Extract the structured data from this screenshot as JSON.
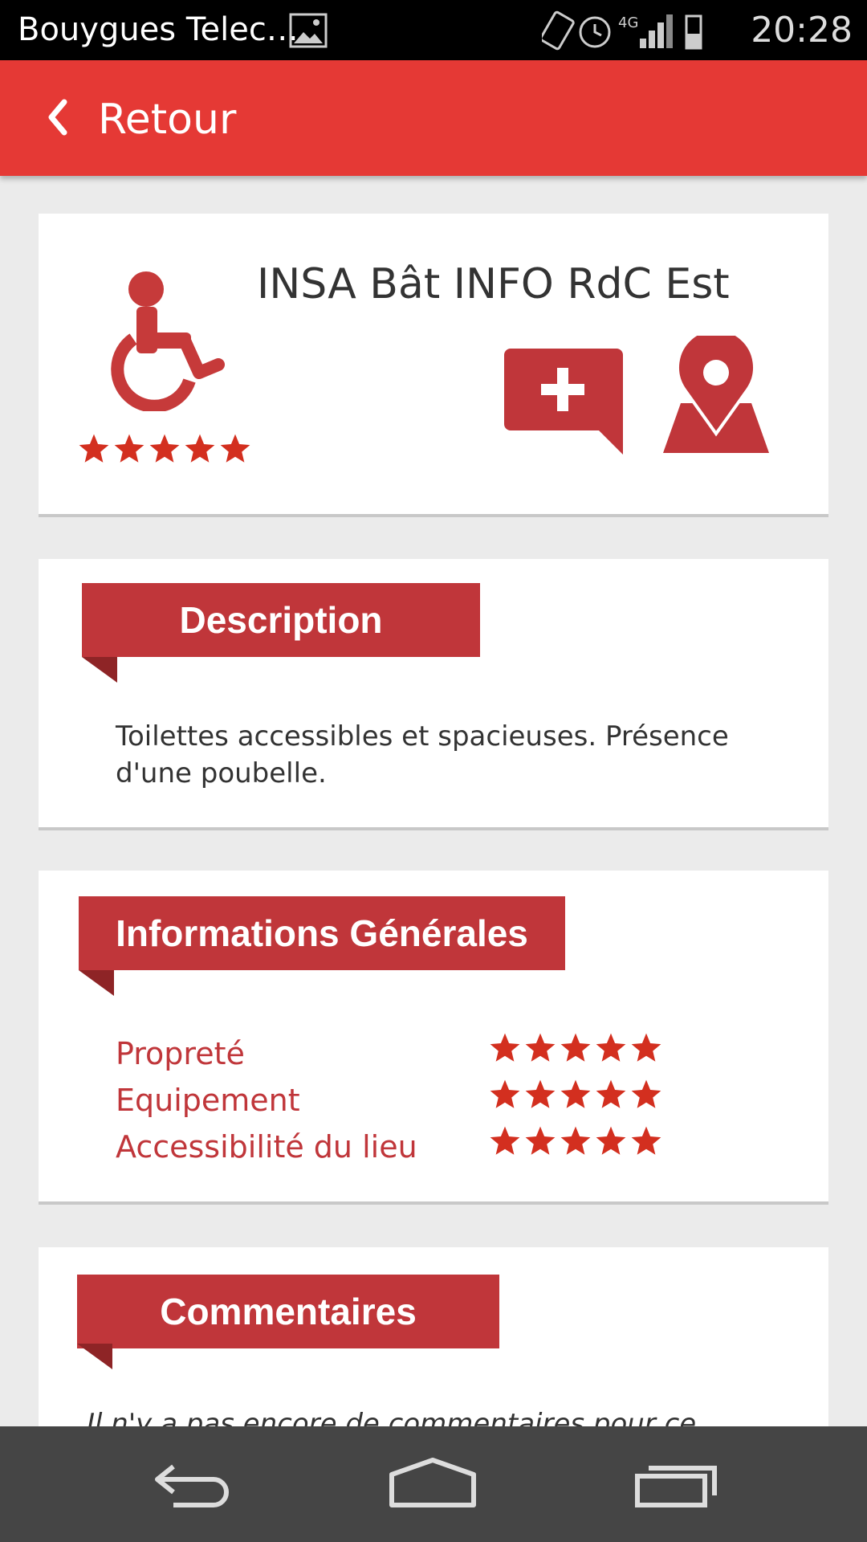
{
  "status_bar": {
    "carrier": "Bouygues Telec…",
    "network": "4G",
    "time": "20:28"
  },
  "app_bar": {
    "back_label": "Retour"
  },
  "place": {
    "title": "INSA Bât INFO RdC Est",
    "overall_rating": 5,
    "overall_rating_max": 5
  },
  "description": {
    "heading": "Description",
    "text": "Toilettes accessibles et spacieuses. Présence d'une poubelle."
  },
  "general_info": {
    "heading": "Informations Générales",
    "ratings": [
      {
        "label": "Propreté",
        "value": 5,
        "max": 5
      },
      {
        "label": "Equipement",
        "value": 5,
        "max": 5
      },
      {
        "label": "Accessibilité du lieu",
        "value": 5,
        "max": 5
      }
    ]
  },
  "comments": {
    "heading": "Commentaires",
    "empty_text": "Il n'y a pas encore de commentaires pour ce"
  },
  "colors": {
    "app_bar": "#e53935",
    "accent": "#c0363a",
    "star": "#d32f1f",
    "background": "#ebebeb"
  },
  "icons": {
    "back": "chevron-left-icon",
    "accessibility": "wheelchair-icon",
    "add_comment": "comment-plus-icon",
    "map": "map-pin-icon",
    "nav_back": "back-arrow-icon",
    "nav_home": "home-icon",
    "nav_recents": "recents-icon"
  }
}
